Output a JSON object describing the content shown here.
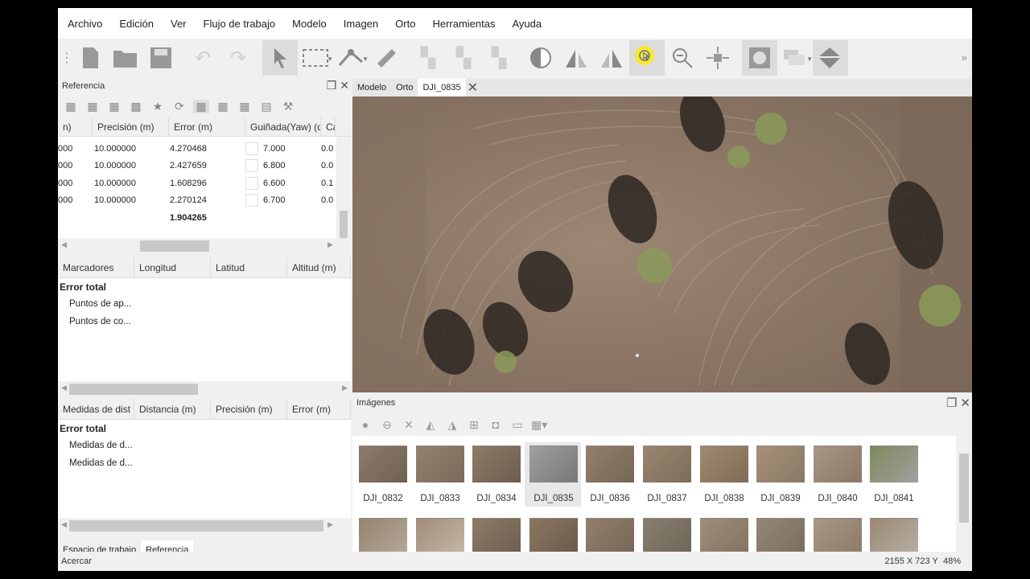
{
  "menu": [
    "Archivo",
    "Edición",
    "Ver",
    "Flujo de trabajo",
    "Modelo",
    "Imagen",
    "Orto",
    "Herramientas",
    "Ayuda"
  ],
  "toolbar_icons": [
    "new-document-icon",
    "open-folder-icon",
    "save-icon",
    "undo-icon",
    "redo-icon",
    "pointer-icon",
    "rectangle-select-icon",
    "ruler-icon",
    "measure-icon",
    "pair-1-icon",
    "pair-2-icon",
    "pair-3-icon",
    "contrast-icon",
    "rotate-left-icon",
    "rotate-right-icon",
    "zoom-in-icon",
    "zoom-out-icon",
    "fit-icon",
    "mask-icon",
    "overlay-icon",
    "patch-icon"
  ],
  "reference_panel": {
    "title": "Referencia",
    "columns": [
      "n)",
      "Precisión (m)",
      "Error (m)",
      "Guiñada(Yaw) (de",
      "Ca"
    ],
    "rows": [
      {
        "c0": "000",
        "precision": "10.000000",
        "error": "4.270468",
        "yaw": "7.000",
        "c4": "0.0"
      },
      {
        "c0": "000",
        "precision": "10.000000",
        "error": "2.427659",
        "yaw": "6.800",
        "c4": "0.0"
      },
      {
        "c0": "000",
        "precision": "10.000000",
        "error": "1.608296",
        "yaw": "6.600",
        "c4": "0.1"
      },
      {
        "c0": "000",
        "precision": "10.000000",
        "error": "2.270124",
        "yaw": "6.700",
        "c4": "0.0"
      }
    ],
    "total_error": "1.904265"
  },
  "markers_table": {
    "columns": [
      "Marcadores",
      "Longitud",
      "Latitud",
      "Altitud (m)"
    ],
    "group": "Error total",
    "items": [
      "Puntos de ap...",
      "Puntos de co..."
    ]
  },
  "distances_table": {
    "columns": [
      "Medidas de dist",
      "Distancia (m)",
      "Precisión (m)",
      "Error (m)"
    ],
    "group": "Error total",
    "items": [
      "Medidas de d...",
      "Medidas de d..."
    ]
  },
  "bottom_tabs": [
    "Espacio de trabajo",
    "Referencia"
  ],
  "view_tabs": [
    "Modelo",
    "Orto",
    "DJI_0835"
  ],
  "images_panel": {
    "title": "Imágenes",
    "thumbnails": [
      "DJI_0832",
      "DJI_0833",
      "DJI_0834",
      "DJI_0835",
      "DJI_0836",
      "DJI_0837",
      "DJI_0838",
      "DJI_0839",
      "DJI_0840",
      "DJI_0841"
    ],
    "selected": "DJI_0835"
  },
  "status": {
    "left": "Acercar",
    "coords": "2155 X  723 Y",
    "zoom": "48%"
  }
}
